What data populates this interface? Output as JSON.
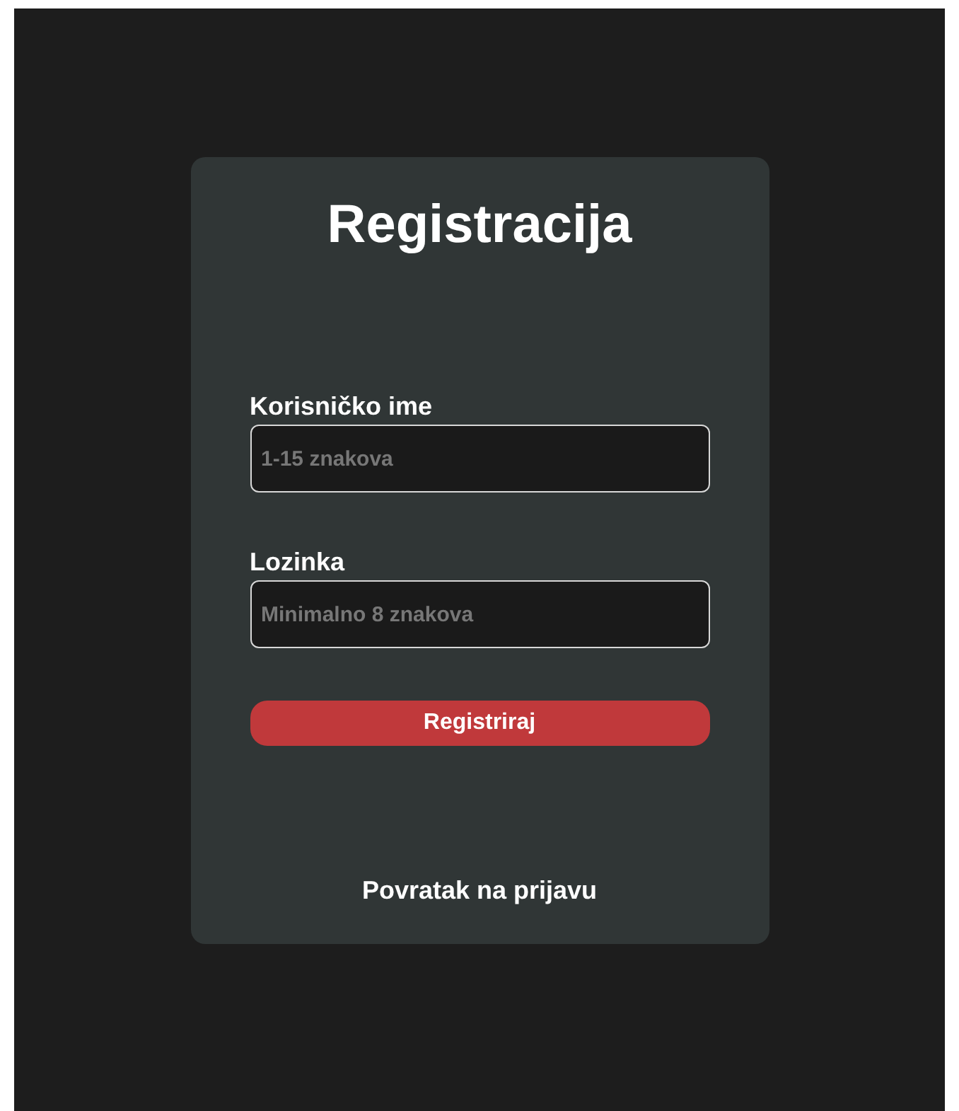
{
  "title": "Registracija",
  "fields": [
    {
      "label": "Korisničko ime",
      "placeholder": "1-15 znakova"
    },
    {
      "label": "Lozinka",
      "placeholder": "Minimalno 8 znakova"
    }
  ],
  "submit": "Registriraj",
  "back_link": "Povratak na prijavu"
}
